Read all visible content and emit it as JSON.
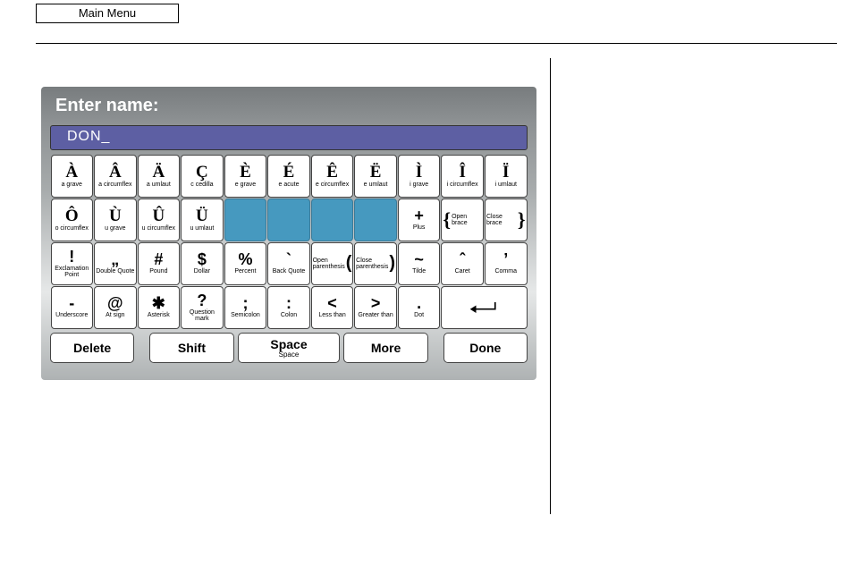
{
  "header": {
    "main_menu": "Main Menu"
  },
  "panel": {
    "title": "Enter name:",
    "input_value": "DON_"
  },
  "rows": [
    [
      {
        "main": "À",
        "sub": "a grave"
      },
      {
        "main": "Â",
        "sub": "a circumflex"
      },
      {
        "main": "Ä",
        "sub": "a umlaut"
      },
      {
        "main": "Ç",
        "sub": "c cedilla"
      },
      {
        "main": "È",
        "sub": "e grave"
      },
      {
        "main": "É",
        "sub": "e acute"
      },
      {
        "main": "Ê",
        "sub": "e circumflex"
      },
      {
        "main": "Ë",
        "sub": "e umlaut"
      },
      {
        "main": "Ì",
        "sub": "i grave"
      },
      {
        "main": "Î",
        "sub": "i circumflex"
      },
      {
        "main": "Ï",
        "sub": "i umlaut"
      }
    ],
    [
      {
        "main": "Ô",
        "sub": "o circumflex"
      },
      {
        "main": "Ù",
        "sub": "u grave"
      },
      {
        "main": "Û",
        "sub": "u circumflex"
      },
      {
        "main": "Ü",
        "sub": "u umlaut"
      },
      {
        "blank": true
      },
      {
        "blank": true
      },
      {
        "blank": true
      },
      {
        "blank": true
      },
      {
        "main": "+",
        "sub": "Plus",
        "sym": true
      },
      {
        "brace": "{",
        "btxt": "Open brace"
      },
      {
        "brace": "}",
        "btxt": "Close brace"
      }
    ],
    [
      {
        "main": "!",
        "sub": "Exclamation Point",
        "sym": true
      },
      {
        "main": "\"",
        "sub": "Double Quote",
        "sym": true,
        "altmain": "„"
      },
      {
        "main": "#",
        "sub": "Pound",
        "sym": true
      },
      {
        "main": "$",
        "sub": "Dollar",
        "sym": true
      },
      {
        "main": "%",
        "sub": "Percent",
        "sym": true
      },
      {
        "main": "`",
        "sub": "Back Quote",
        "sym": true
      },
      {
        "paren": "(",
        "ptxt": "Open parenthesis"
      },
      {
        "paren": ")",
        "ptxt": "Close parenthesis"
      },
      {
        "main": "~",
        "sub": "Tilde",
        "sym": true
      },
      {
        "main": "ˆ",
        "sub": "Caret",
        "sym": true
      },
      {
        "main": ",",
        "sub": "Comma",
        "sym": true,
        "altmain": "’"
      }
    ],
    [
      {
        "main": "_",
        "sub": "Underscore",
        "sym": true,
        "altmain": "-"
      },
      {
        "main": "@",
        "sub": "At sign",
        "sym": true
      },
      {
        "main": "✱",
        "sub": "Asterisk",
        "sym": true
      },
      {
        "main": "?",
        "sub": "Question mark",
        "sym": true
      },
      {
        "main": ";",
        "sub": "Semicolon",
        "sym": true
      },
      {
        "main": ":",
        "sub": "Colon",
        "sym": true
      },
      {
        "main": "<",
        "sub": "Less than",
        "sym": true
      },
      {
        "main": ">",
        "sub": "Greater than",
        "sym": true
      },
      {
        "main": ".",
        "sub": "Dot",
        "sym": true
      },
      {
        "enter": true,
        "span": 2
      }
    ]
  ],
  "bottom": {
    "delete": "Delete",
    "shift": "Shift",
    "space": "Space",
    "space_sub": "Space",
    "more": "More",
    "done": "Done"
  }
}
